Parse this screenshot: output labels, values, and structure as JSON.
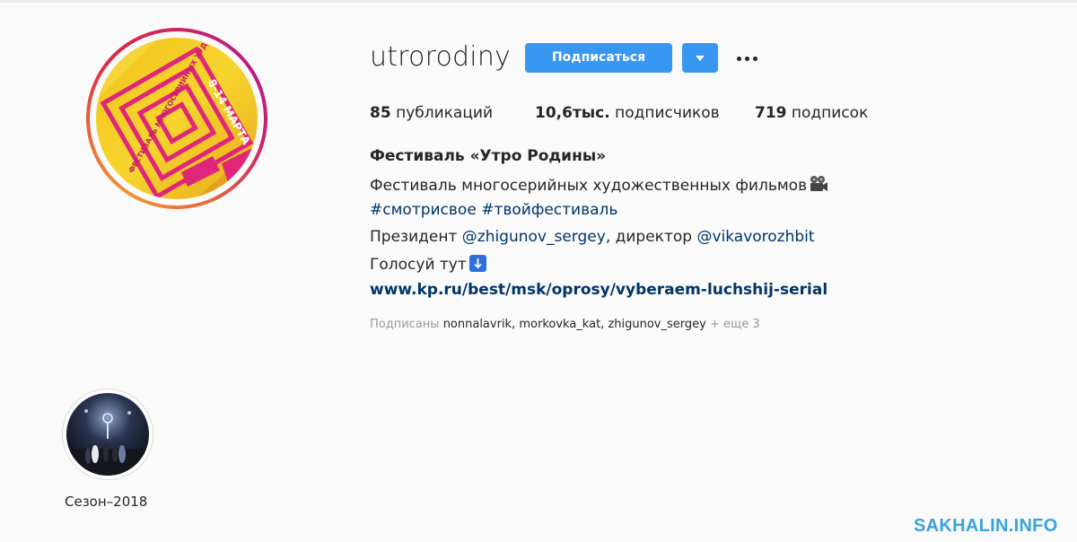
{
  "profile": {
    "username": "utrorodiny",
    "follow_label": "Подписаться",
    "avatar_logo_text": "ФЕСТИВАЛЬ МНОГОСЕРИЙНЫХ ХУДОЖЕСТВЕННЫХ ФИЛЬМОВ",
    "avatar_date_text": "8-14 МАРТА"
  },
  "stats": {
    "posts_count": "85",
    "posts_label": "публикаций",
    "followers_count": "10,6тыс.",
    "followers_label": "подписчиков",
    "following_count": "719",
    "following_label": "подписок"
  },
  "bio": {
    "name": "Фестиваль «Утро Родины»",
    "line1": "Фестиваль многосерийных художественных фильмов",
    "hashtag1": "#смотрисвое",
    "hashtag2": "#твойфестиваль",
    "line3_prefix": "Президент ",
    "mention1": "@zhigunov_sergey",
    "line3_mid": ", директор ",
    "mention2": "@vikavorozhbit",
    "line4": "Голосуй тут",
    "link": "www.kp.ru/best/msk/oprosy/vyberaem-luchshij-serial"
  },
  "followed_by": {
    "prefix": "Подписаны ",
    "user1": "nonnalavrik",
    "sep1": ", ",
    "user2": "morkovka_kat",
    "sep2": ", ",
    "user3": "zhigunov_sergey",
    "more": " + еще 3"
  },
  "highlights": [
    {
      "label": "Сезон–2018"
    }
  ],
  "watermark": "SAKHALIN.INFO",
  "colors": {
    "accent": "#3897f0",
    "link": "#003569",
    "text": "#262626",
    "muted": "#999999",
    "watermark": "#3aa3dc"
  },
  "icons": {
    "dropdown": "caret-down-icon",
    "more": "more-options-icon",
    "camera_emoji": "movie-camera-icon",
    "down_arrow_emoji": "down-arrow-icon"
  }
}
